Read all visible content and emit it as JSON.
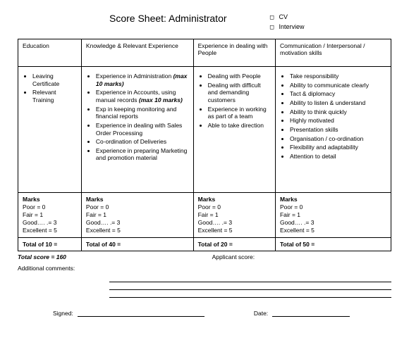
{
  "title": "Score Sheet:  Administrator",
  "checks": {
    "cv": "CV",
    "interview": "Interview"
  },
  "columns": {
    "c1": {
      "header": "Education",
      "items": [
        "Leaving Certificate",
        "Relevant Training"
      ]
    },
    "c2": {
      "header": "Knowledge & Relevant Experience",
      "items": [
        "Experience in Administration",
        "(max 10 marks)",
        "Experience in Accounts, using manual records",
        "(max 10 marks)",
        "Exp in keeping monitoring and financial reports",
        "Experience in dealing with Sales Order Processing",
        "Co-ordination of Deliveries",
        "Experience in preparing Marketing and promotion material"
      ]
    },
    "c3": {
      "header": "Experience in dealing with People",
      "items": [
        "Dealing with People",
        "Dealing with difficult and demanding customers",
        "Experience in working as part of a team",
        "Able to take direction"
      ]
    },
    "c4": {
      "header": "Communication / Interpersonal / motivation skills",
      "items": [
        "Take responsibility",
        "Ability to communicate clearly",
        "Tact & diplomacy",
        "Ability to listen & understand",
        "Ability to think quickly",
        "Highly motivated",
        "Presentation skills",
        "Organisation / co-ordination",
        "Flexibility and adaptability",
        "Attention to detail"
      ]
    }
  },
  "marks": {
    "heading": "Marks",
    "lines": [
      "Poor      =  0",
      "Fair       =  1",
      "Good…. .=  3",
      "Excellent  =  5"
    ]
  },
  "totals": {
    "c1": "Total of 10 =",
    "c2": "Total of 40 =",
    "c3": "Total of 20 =",
    "c4": "Total of 50 ="
  },
  "total_score": "Total score = 160",
  "applicant_score": "Applicant score:",
  "additional_comments": "Additional comments:",
  "signed": "Signed:",
  "date": "Date:"
}
